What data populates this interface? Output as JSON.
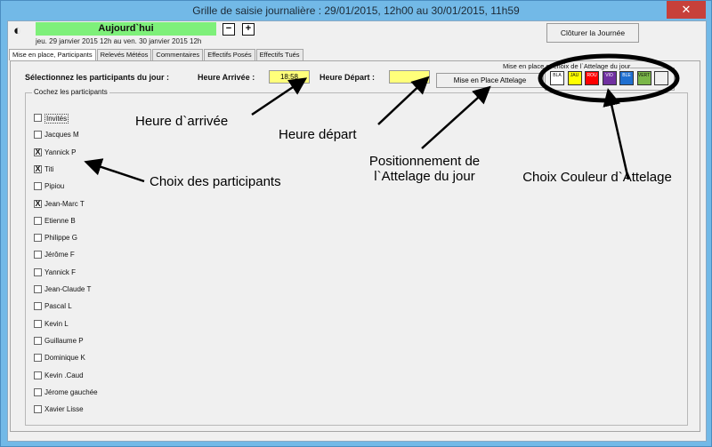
{
  "window": {
    "title": "Grille de saisie journalière  : 29/01/2015, 12h00 au 30/01/2015, 11h59",
    "close": "✕"
  },
  "header": {
    "today": "Aujourd`hui",
    "period": "jeu. 29 janvier 2015 12h au ven. 30 janvier 2015 12h",
    "prev": "−",
    "next": "+",
    "close_day": "Clôturer la Journée"
  },
  "tabs": [
    {
      "label": "Mise en place, Participants",
      "active": true
    },
    {
      "label": "Relevés Météos",
      "active": false
    },
    {
      "label": "Commentaires",
      "active": false
    },
    {
      "label": "Effectifs Posés",
      "active": false
    },
    {
      "label": "Effectifs Tués",
      "active": false
    }
  ],
  "form": {
    "select_label": "Sélectionnez les participants du jour :",
    "arrival_label": "Heure Arrivée :",
    "arrival_value": "18:58",
    "departure_label": "Heure Départ :",
    "departure_value": "",
    "attelage_button": "Mise en Place Attelage",
    "colors_legend": "Mise en place  et choix de l`Attelage du jour"
  },
  "colors": [
    {
      "label": "BLA",
      "color": "#ffffff"
    },
    {
      "label": "JAU",
      "color": "#ffff00"
    },
    {
      "label": "ROU",
      "color": "#ff0000"
    },
    {
      "label": "VIO",
      "color": "#7030a0"
    },
    {
      "label": "BLE",
      "color": "#1f6fd0"
    },
    {
      "label": "VERT",
      "color": "#7ab648"
    },
    {
      "label": "",
      "color": "#f0f0f0"
    }
  ],
  "participants_legend": "Cochez les participants",
  "participants": [
    {
      "name": "Invités",
      "checked": false
    },
    {
      "name": "Jacques M",
      "checked": false
    },
    {
      "name": "Yannick P",
      "checked": true
    },
    {
      "name": "Titi",
      "checked": true
    },
    {
      "name": "Pipiou",
      "checked": false
    },
    {
      "name": "Jean-Marc T",
      "checked": true
    },
    {
      "name": "Etienne B",
      "checked": false
    },
    {
      "name": "Philippe G",
      "checked": false
    },
    {
      "name": "Jérôme F",
      "checked": false
    },
    {
      "name": "Yannick F",
      "checked": false
    },
    {
      "name": "Jean-Claude T",
      "checked": false
    },
    {
      "name": "Pascal L",
      "checked": false
    },
    {
      "name": "Kevin L",
      "checked": false
    },
    {
      "name": "Guillaume P",
      "checked": false
    },
    {
      "name": "Dominique K",
      "checked": false
    },
    {
      "name": "Kevin .Caud",
      "checked": false
    },
    {
      "name": "Jérome gauchée",
      "checked": false
    },
    {
      "name": "Xavier Lisse",
      "checked": false
    }
  ],
  "annotations": {
    "arrival": "Heure d`arrivée",
    "departure": "Heure départ",
    "participants": "Choix des participants",
    "positioning": "Positionnement de l`Attelage du jour",
    "color": "Choix Couleur d`Attelage"
  }
}
